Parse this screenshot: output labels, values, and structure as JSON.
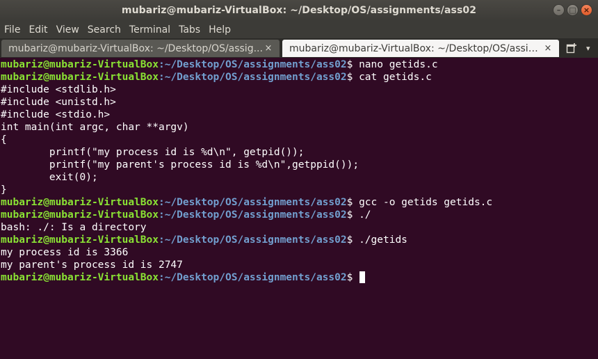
{
  "window": {
    "title": "mubariz@mubariz-VirtualBox: ~/Desktop/OS/assignments/ass02",
    "minimize_label": "–",
    "maximize_label": "□",
    "close_label": "×"
  },
  "menu": {
    "file": "File",
    "edit": "Edit",
    "view": "View",
    "search": "Search",
    "terminal": "Terminal",
    "tabs": "Tabs",
    "help": "Help"
  },
  "tabs": [
    {
      "label": "mubariz@mubariz-VirtualBox: ~/Desktop/OS/assig...",
      "close": "×",
      "active": false
    },
    {
      "label": "mubariz@mubariz-VirtualBox: ~/Desktop/OS/assig...",
      "close": "×",
      "active": true
    }
  ],
  "tab_bar": {
    "new_tab_icon": "new-tab-icon",
    "menu_arrow": "▾"
  },
  "prompt": {
    "user": "mubariz@mubariz-VirtualBox",
    "path": ":~/Desktop/OS/assignments/ass02",
    "symbol": "$ "
  },
  "terminal": {
    "lines": [
      {
        "type": "prompt",
        "cmd": "nano getids.c"
      },
      {
        "type": "prompt",
        "cmd": "cat getids.c"
      },
      {
        "type": "output",
        "text": "#include <stdlib.h>"
      },
      {
        "type": "output",
        "text": "#include <unistd.h>"
      },
      {
        "type": "output",
        "text": "#include <stdio.h>"
      },
      {
        "type": "output",
        "text": "int main(int argc, char **argv)"
      },
      {
        "type": "output",
        "text": "{"
      },
      {
        "type": "output",
        "text": "        printf(\"my process id is %d\\n\", getpid());"
      },
      {
        "type": "output",
        "text": "        printf(\"my parent's process id is %d\\n\",getppid());"
      },
      {
        "type": "output",
        "text": "        exit(0);"
      },
      {
        "type": "output",
        "text": "}"
      },
      {
        "type": "prompt",
        "cmd": "gcc -o getids getids.c"
      },
      {
        "type": "prompt",
        "cmd": "./"
      },
      {
        "type": "output",
        "text": "bash: ./: Is a directory"
      },
      {
        "type": "prompt",
        "cmd": "./getids"
      },
      {
        "type": "output",
        "text": "my process id is 3366"
      },
      {
        "type": "output",
        "text": "my parent's process id is 2747"
      },
      {
        "type": "prompt",
        "cmd": "",
        "cursor": true
      }
    ]
  },
  "colors": {
    "background": "#300a24",
    "prompt_user": "#8ae234",
    "prompt_path": "#729fcf",
    "text": "#ffffff"
  }
}
